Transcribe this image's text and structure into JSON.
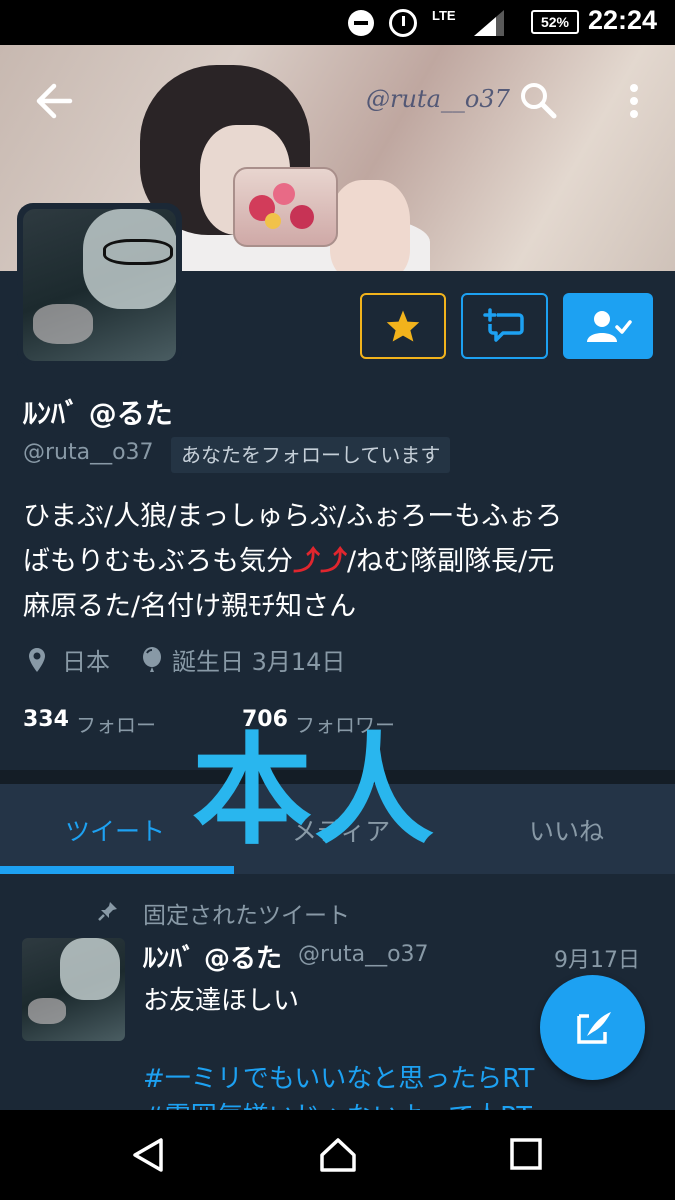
{
  "status_bar": {
    "network": "LTE",
    "battery": "52%",
    "time": "22:24"
  },
  "header": {
    "banner_watermark": "@ruta__o37"
  },
  "profile": {
    "display_name": "ﾙﾝﾊﾞ @るた",
    "handle": "@ruta__o37",
    "follows_you": "あなたをフォローしています",
    "bio_line1": "ひまぶ/人狼/まっしゅらぶ/ふぉろーもふぉろ",
    "bio_line2_a": "ばもりむもぶろも気分",
    "bio_line2_arrows": "⤴⤴",
    "bio_line2_b": "/ねむ隊副隊長/元",
    "bio_line3": "麻原るた/名付け親ﾓﾁ知さん",
    "location": "日本",
    "birthday": "誕生日 3月14日",
    "following_count": "334",
    "following_label": "フォロー",
    "followers_count": "706",
    "followers_label": "フォロワー"
  },
  "tabs": [
    {
      "label": "ツイート",
      "active": true
    },
    {
      "label": "メディア",
      "active": false
    },
    {
      "label": "いいね",
      "active": false
    }
  ],
  "overlay_text": "本人",
  "pinned_tweet": {
    "pinned_label": "固定されたツイート",
    "author": "ﾙﾝﾊﾞ @るた",
    "handle": "@ruta__o37",
    "date": "9月17日",
    "text": "お友達ほしい",
    "hashtag1": "#一ミリでもいいなと思ったらRT",
    "hashtag2": "#雰囲気嫌いじゃないよって人RT"
  },
  "colors": {
    "background": "#1b2836",
    "accent": "#1da1f2",
    "favorite": "#f2b31c",
    "overlay": "#29b6ee"
  },
  "icons": {
    "back": "back-arrow-icon",
    "search": "search-icon",
    "more": "more-vert-icon",
    "favorite": "star-icon",
    "message": "message-icon",
    "following": "person-check-icon",
    "location": "location-pin-icon",
    "birthday": "balloon-icon",
    "pin": "pin-icon",
    "compose": "compose-icon",
    "nav_back": "triangle-back-icon",
    "nav_home": "home-icon",
    "nav_recents": "square-recents-icon"
  }
}
